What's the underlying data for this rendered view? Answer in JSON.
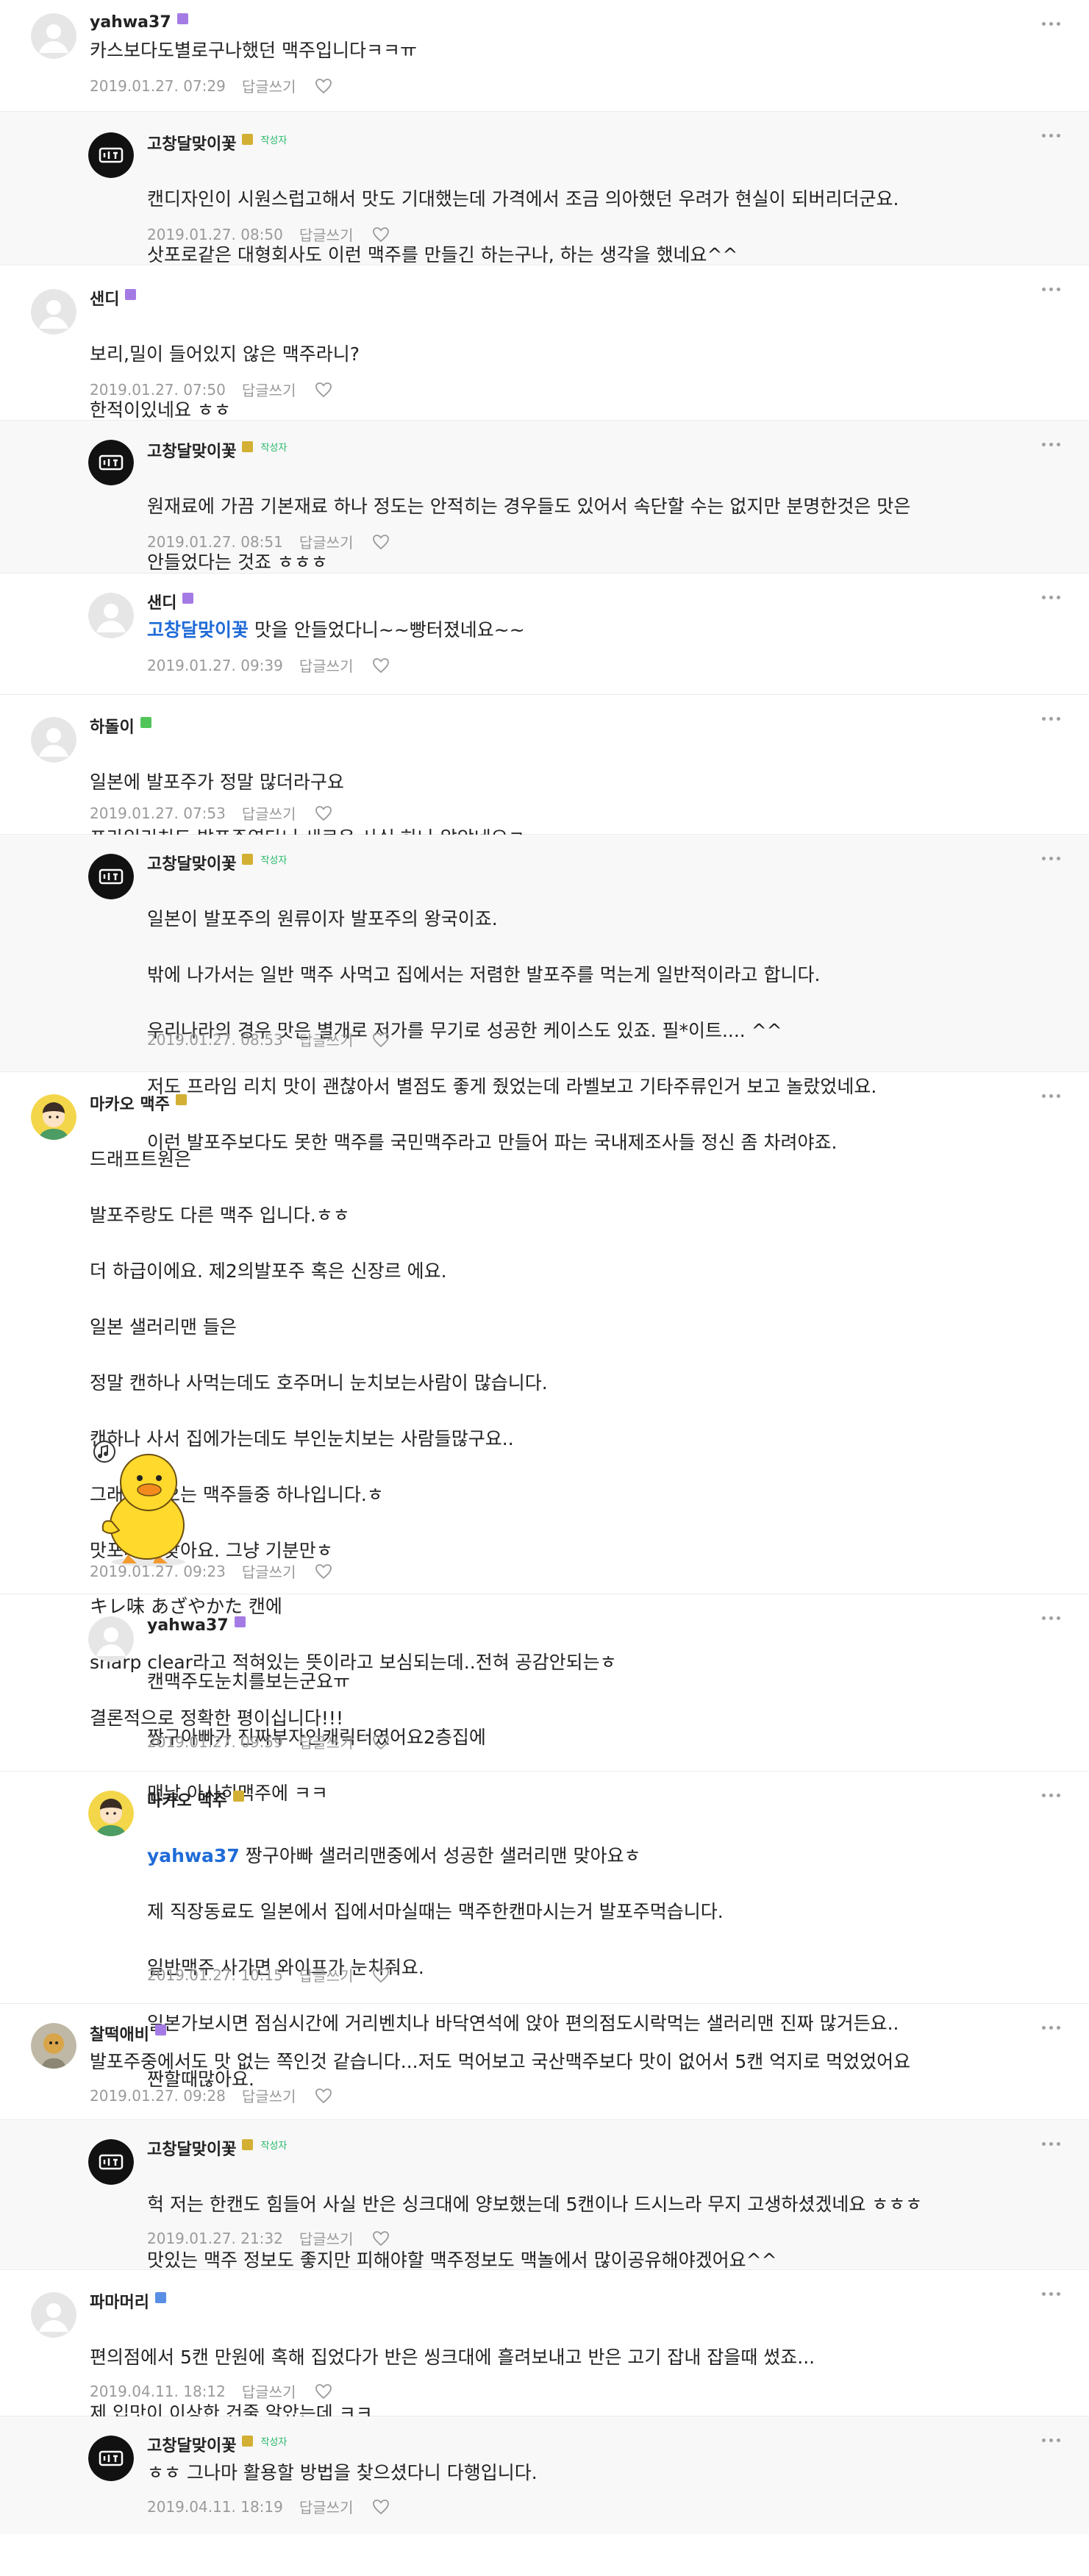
{
  "comments": [
    {
      "nickname": "yahwa37",
      "author_tag": "",
      "lines": [
        "카스보다도별로구나했던 맥주입니다ㅋㅋㅠ"
      ],
      "date": "2019.01.27. 07:29",
      "reply_label": "답글쓰기"
    },
    {
      "nickname": "고창달맞이꽃",
      "author_tag": "작성자",
      "lines": [
        "캔디자인이 시원스럽고해서 맛도 기대했는데 가격에서 조금 의아했던 우려가 현실이 되버리더군요.",
        "삿포로같은 대형회사도 이런 맥주를 만들긴 하는구나, 하는 생각을 했네요^^"
      ],
      "date": "2019.01.27. 08:50",
      "reply_label": "답글쓰기"
    },
    {
      "nickname": "샌디",
      "author_tag": "",
      "lines": [
        "보리,밀이 들어있지 않은 맥주라니?",
        "한적이있네요 ㅎㅎ"
      ],
      "date": "2019.01.27. 07:50",
      "reply_label": "답글쓰기"
    },
    {
      "nickname": "고창달맞이꽃",
      "author_tag": "작성자",
      "lines": [
        "원재료에 가끔 기본재료 하나 정도는 안적히는 경우들도 있어서 속단할 수는 없지만 분명한것은 맛은",
        "안들었다는 것죠 ㅎㅎㅎ"
      ],
      "date": "2019.01.27. 08:51",
      "reply_label": "답글쓰기"
    },
    {
      "nickname": "샌디",
      "author_tag": "",
      "mention": "고창달맞이꽃",
      "lines": [
        "맛을 안들었다니~~빵터졌네요~~"
      ],
      "date": "2019.01.27. 09:39",
      "reply_label": "답글쓰기"
    },
    {
      "nickname": "하돌이",
      "author_tag": "",
      "lines": [
        "일본에 발포주가 정말 많더라구요",
        "프라임리치도 발포주였다니 새로운 사실 하나 알았네요ㅋ"
      ],
      "date": "2019.01.27. 07:53",
      "reply_label": "답글쓰기"
    },
    {
      "nickname": "고창달맞이꽃",
      "author_tag": "작성자",
      "lines": [
        "일본이 발포주의 원류이자 발포주의 왕국이죠.",
        "밖에 나가서는 일반 맥주 사먹고 집에서는 저렴한 발포주를 먹는게 일반적이라고 합니다.",
        "우리나라의 경우 맛은 별개로 저가를 무기로 성공한 케이스도 있죠. 필*이트.... ^^",
        "저도 프라임 리치 맛이 괜찮아서 별점도 좋게 줬었는데 라벨보고 기타주류인거 보고 놀랐었네요.",
        "이런 발포주보다도 못한 맥주를 국민맥주라고 만들어 파는 국내제조사들 정신 좀 차려야죠."
      ],
      "date": "2019.01.27. 08:53",
      "reply_label": "답글쓰기"
    },
    {
      "nickname": "마카오 맥주",
      "author_tag": "",
      "lines": [
        "드래프트원은",
        "발포주랑도 다른 맥주 입니다.ㅎㅎ",
        "더 하급이에요. 제2의발포주 혹은 신장르 에요.",
        "일본 샐러리맨 들은",
        "정말 캔하나 사먹는데도 호주머니 눈치보는사람이 많습니다.",
        "캔하나 사서 집에가는데도 부인눈치보는 사람들많구요..",
        "그래서 나오는 맥주들중 하나입니다.ㅎ",
        "맛포기가 맞아요. 그냥 기분만ㅎ",
        "キレ味 あざやかた 캔에",
        "sharp clear라고 적혀있는 뜻이라고 보심되는데..전혀 공감안되는ㅎ",
        "결론적으로 정확한 평이십니다!!!"
      ],
      "date": "2019.01.27. 09:23",
      "reply_label": "답글쓰기"
    },
    {
      "nickname": "yahwa37",
      "author_tag": "",
      "lines": [
        "캔맥주도눈치를보는군요ㅠ",
        "짱구아빠가 진짜부자인캐릭터였어요2층집에",
        "맨날 아사히맥주에 ㅋㅋ"
      ],
      "date": "2019.01.27. 09:59",
      "reply_label": "답글쓰기"
    },
    {
      "nickname": "마카오 맥주",
      "author_tag": "",
      "mention": "yahwa37",
      "lines": [
        "짱구아빠 샐러리맨중에서 성공한 샐러리맨 맞아요ㅎ",
        "제 직장동료도 일본에서 집에서마실때는 맥주한캔마시는거 발포주먹습니다.",
        "일반맥주 사가면 와이프가 눈치줘요.",
        "일본가보시면 점심시간에 거리벤치나 바닥연석에 앉아 편의점도시락먹는 샐러리맨 진짜 많거든요..",
        "짠할때많아요."
      ],
      "date": "2019.01.27. 10:15",
      "reply_label": "답글쓰기"
    },
    {
      "nickname": "찰떡애비",
      "author_tag": "",
      "lines": [
        "발포주중에서도 맛 없는 쪽인것 같습니다...저도 먹어보고 국산맥주보다 맛이 없어서 5캔 억지로 먹었었어요"
      ],
      "date": "2019.01.27. 09:28",
      "reply_label": "답글쓰기"
    },
    {
      "nickname": "고창달맞이꽃",
      "author_tag": "작성자",
      "lines": [
        "헉 저는 한캔도 힘들어 사실 반은 싱크대에 양보했는데 5캔이나 드시느라 무지 고생하셨겠네요 ㅎㅎㅎ",
        "맛있는 맥주 정보도 좋지만 피해야할 맥주정보도 맥놀에서 많이공유해야겠어요^^"
      ],
      "date": "2019.01.27. 21:32",
      "reply_label": "답글쓰기"
    },
    {
      "nickname": "파마머리",
      "author_tag": "",
      "lines": [
        "편의점에서 5캔 만원에 혹해 집었다가 반은 씽크대에 흘려보내고 반은 고기 잡내 잡을때 썼죠...",
        "제 입맛이 이상한 건줄 알았는데 ㅋㅋ"
      ],
      "date": "2019.04.11. 18:12",
      "reply_label": "답글쓰기"
    },
    {
      "nickname": "고창달맞이꽃",
      "author_tag": "작성자",
      "lines": [
        "ㅎㅎ 그나마 활용할 방법을 찾으셨다니 다행입니다."
      ],
      "date": "2019.04.11. 18:19",
      "reply_label": "답글쓰기"
    }
  ]
}
